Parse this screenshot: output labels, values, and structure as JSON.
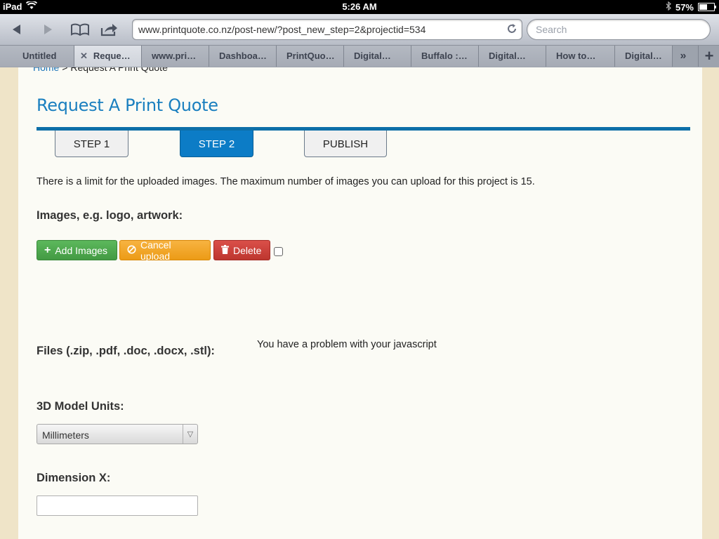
{
  "status_bar": {
    "device": "iPad",
    "time": "5:26 AM",
    "battery": "57%",
    "battery_level": 0.57
  },
  "browser": {
    "url": "www.printquote.co.nz/post-new/?post_new_step=2&projectid=534",
    "search_placeholder": "Search",
    "tabs": [
      {
        "label": "Untitled",
        "active": false
      },
      {
        "label": "Reque…",
        "active": true
      },
      {
        "label": "www.pri…",
        "active": false
      },
      {
        "label": "Dashboa…",
        "active": false
      },
      {
        "label": "PrintQuo…",
        "active": false
      },
      {
        "label": "Digital…",
        "active": false
      },
      {
        "label": "Buffalo :…",
        "active": false
      },
      {
        "label": "Digital…",
        "active": false
      },
      {
        "label": "How to…",
        "active": false
      },
      {
        "label": "Digital…",
        "active": false
      }
    ]
  },
  "page": {
    "breadcrumb_home": "Home",
    "breadcrumb_separator": " > ",
    "breadcrumb_current": "Request A Print Quote",
    "title": "Request A Print Quote",
    "steps": [
      {
        "label": "STEP 1",
        "active": false
      },
      {
        "label": "STEP 2",
        "active": true
      },
      {
        "label": "PUBLISH",
        "active": false
      }
    ],
    "notice": "There is a limit for the uploaded images. The maximum number of images you can upload for this project is 15.",
    "images_label": "Images, e.g. logo, artwork:",
    "buttons": {
      "add_images": "Add Images",
      "cancel_upload": "Cancel upload",
      "delete": "Delete"
    },
    "files_label": "Files (.zip, .pdf, .doc, .docx, .stl):",
    "js_message": "You have a problem with your javascript",
    "units_label": "3D Model Units:",
    "units_value": "Millimeters",
    "dimension_x_label": "Dimension X:",
    "dimension_x_value": ""
  },
  "colors": {
    "accent": "#1a7fbf",
    "step_active": "#0c7cc6",
    "green": "#5cb85c",
    "orange": "#f0a22a",
    "red": "#da4f49"
  }
}
